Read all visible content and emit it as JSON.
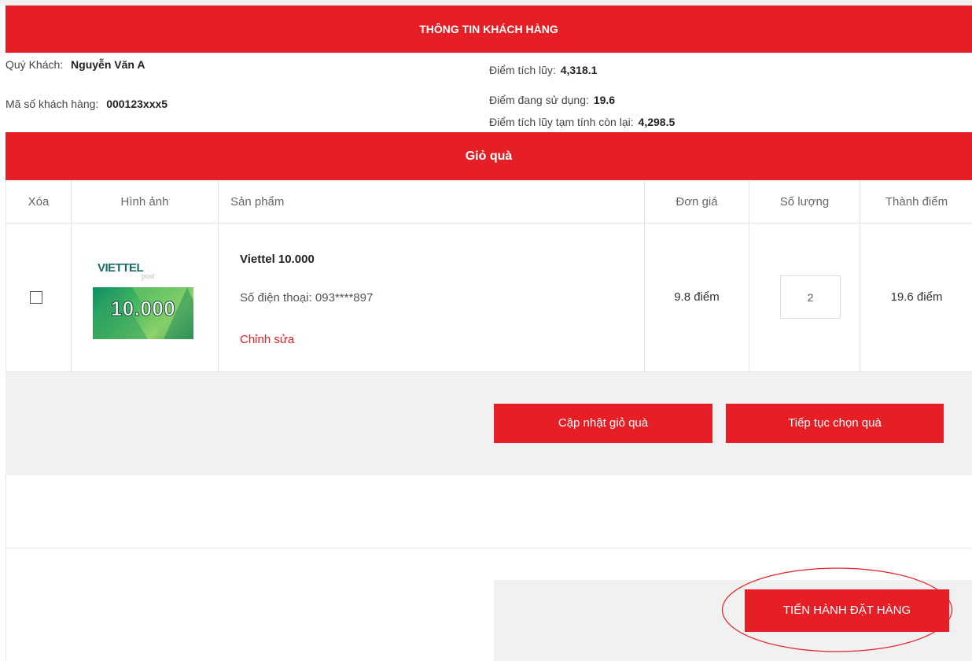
{
  "customer_info": {
    "header": "THÔNG TIN KHÁCH HÀNG",
    "name_label": "Quý Khách:",
    "name_value": "Nguyễn Văn A",
    "id_label": "Mã số khách hàng:",
    "id_value": "000123xxx5",
    "points_label": "Điểm tích lũy:",
    "points_value": "4,318.1",
    "using_label": "Điểm đang sử dụng:",
    "using_value": "19.6",
    "remaining_label": "Điểm tích lũy tạm tính còn lại:",
    "remaining_value": "4,298.5"
  },
  "cart": {
    "header": "Giỏ quà",
    "columns": [
      "Xóa",
      "Hình ảnh",
      "Sản phẩm",
      "Đơn giá",
      "Số lượng",
      "Thành điểm"
    ],
    "items": [
      {
        "checked": false,
        "image": {
          "brand": "VIETTEL",
          "sub": "post",
          "value": "10.000"
        },
        "name": "Viettel 10.000",
        "phone_label": "Số điện thoại:",
        "phone_value": "093****897",
        "edit_label": "Chỉnh sửa",
        "unit_price": "9.8 điểm",
        "quantity": "2",
        "total": "19.6 điểm"
      }
    ]
  },
  "actions": {
    "update_label": "Cập nhật giỏ quà",
    "continue_label": "Tiếp tục chọn quà",
    "checkout_label": "TIẾN HÀNH ĐẶT HÀNG"
  },
  "colors": {
    "brand_red": "#e61e26",
    "panel_gray": "#f1f1f1",
    "border": "#e3e3e3"
  }
}
